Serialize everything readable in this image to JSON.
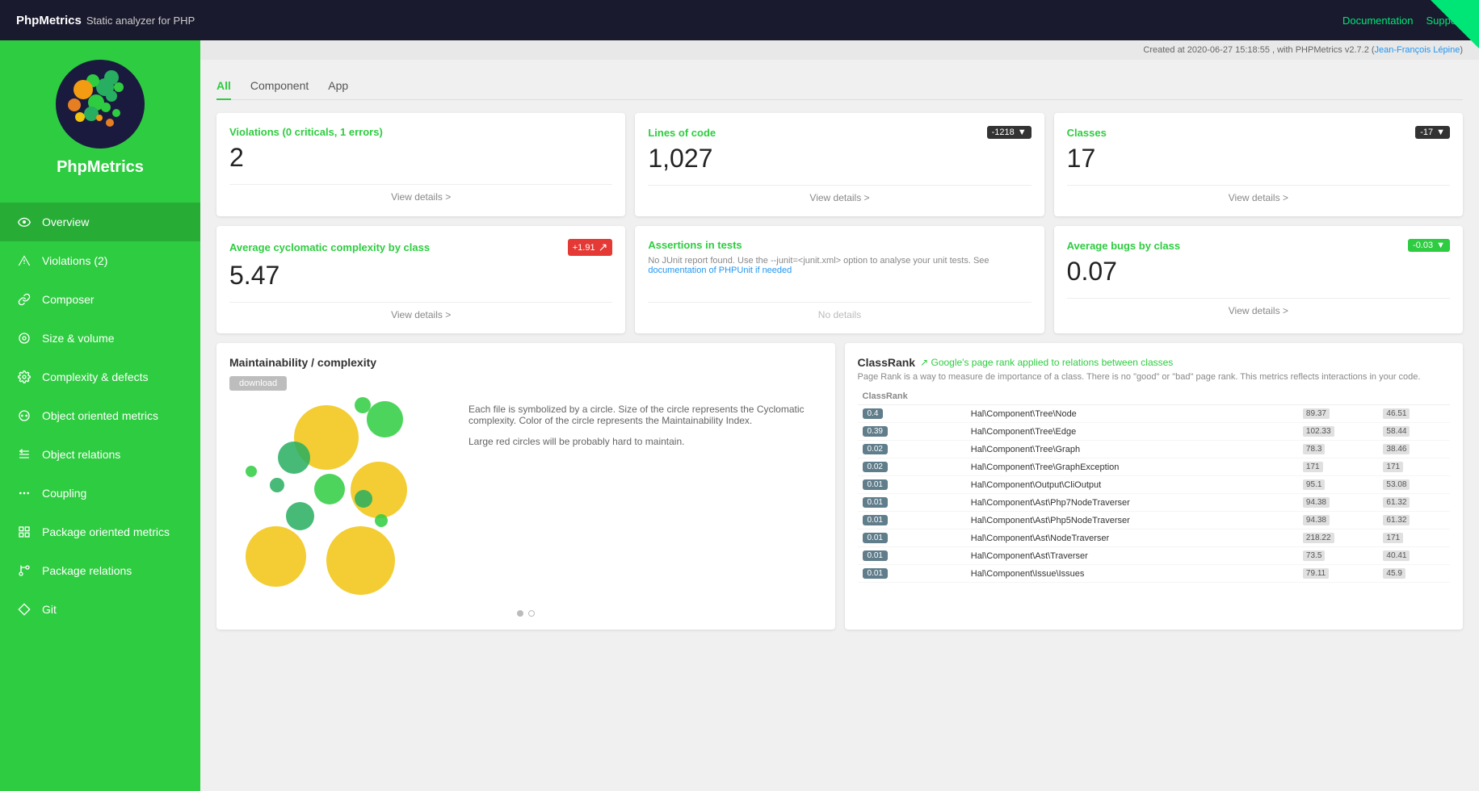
{
  "topbar": {
    "brand_name": "PhpMetrics",
    "brand_subtitle": "Static analyzer for PHP",
    "link_documentation": "Documentation",
    "link_support": "Support"
  },
  "meta": {
    "created_text": "Created at 2020-06-27 15:18:55 , with PHPMetrics v2.7.2 (",
    "author": "Jean-François Lépine",
    "created_suffix": ")"
  },
  "tabs": [
    {
      "id": "all",
      "label": "All",
      "active": true
    },
    {
      "id": "component",
      "label": "Component",
      "active": false
    },
    {
      "id": "app",
      "label": "App",
      "active": false
    }
  ],
  "cards": {
    "violations": {
      "title": "Violations (0 criticals, 1 errors)",
      "value": "2",
      "badge": null,
      "link": "View details >"
    },
    "lines_of_code": {
      "title": "Lines of code",
      "value": "1,027",
      "badge": "-1218",
      "badge_type": "dark",
      "link": "View details >"
    },
    "classes": {
      "title": "Classes",
      "value": "17",
      "badge": "-17",
      "badge_type": "dark",
      "link": "View details >"
    },
    "avg_complexity": {
      "title": "Average cyclomatic complexity by class",
      "value": "5.47",
      "badge": "+1.91",
      "badge_type": "red",
      "link": "View details >"
    },
    "assertions": {
      "title": "Assertions in tests",
      "note": "No JUnit report found. Use the --junit=<junit.xml> option to analyse your unit tests. See  documentation of PHPUnit if needed",
      "link": null
    },
    "avg_bugs": {
      "title": "Average bugs by class",
      "value": "0.07",
      "badge": "-0.03",
      "badge_type": "green",
      "link": "View details >"
    }
  },
  "maintainability": {
    "title": "Maintainability / complexity",
    "download_label": "download",
    "description_1": "Each file is symbolized by a circle. Size of the circle represents the Cyclomatic complexity. Color of the circle represents the Maintainability Index.",
    "description_2": "Large red circles will be probably hard to maintain."
  },
  "classrank": {
    "title": "ClassRank",
    "title_link": "Google's page rank applied to relations between classes",
    "description": "Page Rank is a way to measure de importance of a class. There is no \"good\" or \"bad\" page rank. This metrics reflects interactions in your code.",
    "column": "ClassRank",
    "rows": [
      {
        "rank": "0.4",
        "class": "Hal\\Component\\Tree\\Node",
        "val1": "89.37",
        "val2": "46.51"
      },
      {
        "rank": "0.39",
        "class": "Hal\\Component\\Tree\\Edge",
        "val1": "102.33",
        "val2": "58.44"
      },
      {
        "rank": "0.02",
        "class": "Hal\\Component\\Tree\\Graph",
        "val1": "78.3",
        "val2": "38.46"
      },
      {
        "rank": "0.02",
        "class": "Hal\\Component\\Tree\\GraphException",
        "val1": "171",
        "val2": "171"
      },
      {
        "rank": "0.01",
        "class": "Hal\\Component\\Output\\CliOutput",
        "val1": "95.1",
        "val2": "53.08"
      },
      {
        "rank": "0.01",
        "class": "Hal\\Component\\Ast\\Php7NodeTraverser",
        "val1": "94.38",
        "val2": "61.32"
      },
      {
        "rank": "0.01",
        "class": "Hal\\Component\\Ast\\Php5NodeTraverser",
        "val1": "94.38",
        "val2": "61.32"
      },
      {
        "rank": "0.01",
        "class": "Hal\\Component\\Ast\\NodeTraverser",
        "val1": "218.22",
        "val2": "171"
      },
      {
        "rank": "0.01",
        "class": "Hal\\Component\\Ast\\Traverser",
        "val1": "73.5",
        "val2": "40.41"
      },
      {
        "rank": "0.01",
        "class": "Hal\\Component\\Issue\\Issues",
        "val1": "79.11",
        "val2": "45.9"
      }
    ]
  },
  "sidebar": {
    "logo_title": "PhpMetrics",
    "nav_items": [
      {
        "id": "overview",
        "label": "Overview",
        "icon": "eye"
      },
      {
        "id": "violations",
        "label": "Violations (2)",
        "icon": "alert"
      },
      {
        "id": "composer",
        "label": "Composer",
        "icon": "link"
      },
      {
        "id": "size-volume",
        "label": "Size & volume",
        "icon": "resize"
      },
      {
        "id": "complexity-defects",
        "label": "Complexity & defects",
        "icon": "settings"
      },
      {
        "id": "object-oriented",
        "label": "Object oriented metrics",
        "icon": "circle"
      },
      {
        "id": "object-relations",
        "label": "Object relations",
        "icon": "connect"
      },
      {
        "id": "coupling",
        "label": "Coupling",
        "icon": "dots"
      },
      {
        "id": "package-oriented",
        "label": "Package oriented metrics",
        "icon": "package"
      },
      {
        "id": "package-relations",
        "label": "Package relations",
        "icon": "branch"
      },
      {
        "id": "git",
        "label": "Git",
        "icon": "diamond"
      }
    ]
  }
}
